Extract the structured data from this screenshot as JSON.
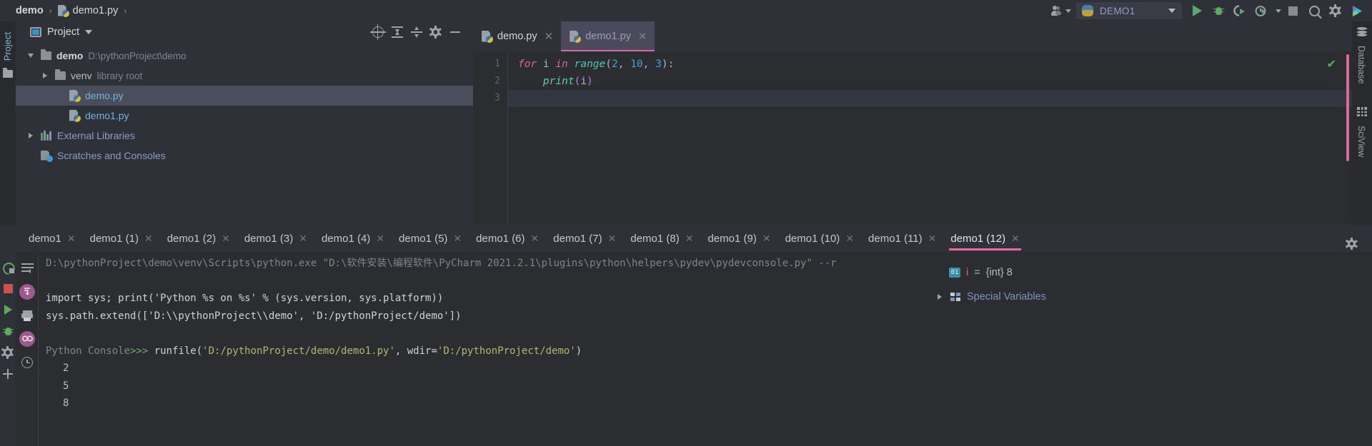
{
  "breadcrumb": {
    "project": "demo",
    "separator": "›",
    "file": "demo1.py",
    "trailing": "›"
  },
  "toolbar": {
    "user_icon": "user-group-icon",
    "run_config": "DEMO1",
    "run_label": "run-icon",
    "debug_label": "debug-icon",
    "coverage_label": "run-with-coverage-icon",
    "profile_label": "profile-icon",
    "stop_label": "stop-icon",
    "search_label": "search-icon",
    "settings_label": "settings-icon",
    "updates_label": "updates-icon"
  },
  "left_strip": {
    "project_label": "Project"
  },
  "project_panel": {
    "title": "Project",
    "tree": [
      {
        "name": "demo",
        "detail": "D:\\pythonProject\\demo",
        "icon": "folder-icon",
        "expanded": true,
        "depth": 0,
        "bold": true,
        "selected": false
      },
      {
        "name": "venv",
        "detail": "library root",
        "icon": "folder-icon",
        "expanded": false,
        "depth": 1,
        "bold": false,
        "selected": false
      },
      {
        "name": "demo.py",
        "detail": "",
        "icon": "python-file-icon",
        "expanded": null,
        "depth": 2,
        "bold": false,
        "selected": true
      },
      {
        "name": "demo1.py",
        "detail": "",
        "icon": "python-file-icon",
        "expanded": null,
        "depth": 2,
        "bold": false,
        "selected": false
      },
      {
        "name": "External Libraries",
        "detail": "",
        "icon": "libraries-icon",
        "expanded": false,
        "depth": 0,
        "bold": false,
        "selected": false
      },
      {
        "name": "Scratches and Consoles",
        "detail": "",
        "icon": "scratches-icon",
        "expanded": null,
        "depth": 0,
        "bold": false,
        "selected": false
      }
    ]
  },
  "editor_toolbar": [
    {
      "name": "select-opened-file-icon"
    },
    {
      "name": "collapse-all-icon"
    },
    {
      "name": "expand-all-icon"
    },
    {
      "name": "settings-icon"
    },
    {
      "name": "hide-icon"
    }
  ],
  "editor": {
    "tabs": [
      {
        "label": "demo.py",
        "active": false
      },
      {
        "label": "demo1.py",
        "active": true
      }
    ],
    "close_glyph": "✕",
    "line_numbers": [
      "1",
      "2",
      "3"
    ],
    "code": {
      "line1": {
        "kw1": "for",
        "var": " i ",
        "kw2": "in",
        "fn": " range",
        "open": "(",
        "a": "2",
        "c1": ", ",
        "b": "10",
        "c2": ", ",
        "c": "3",
        "close": "):"
      },
      "line2": {
        "indent": "    ",
        "fn": "print",
        "open": "(",
        "arg": "i",
        "close": ")"
      }
    },
    "inspection_status": "✔"
  },
  "right_strip": {
    "database": "Database",
    "sciview": "SciView"
  },
  "console_tabs": {
    "tabs": [
      {
        "label": "demo1",
        "active": false
      },
      {
        "label": "demo1 (1)",
        "active": false
      },
      {
        "label": "demo1 (2)",
        "active": false
      },
      {
        "label": "demo1 (3)",
        "active": false
      },
      {
        "label": "demo1 (4)",
        "active": false
      },
      {
        "label": "demo1 (5)",
        "active": false
      },
      {
        "label": "demo1 (6)",
        "active": false
      },
      {
        "label": "demo1 (7)",
        "active": false
      },
      {
        "label": "demo1 (8)",
        "active": false
      },
      {
        "label": "demo1 (9)",
        "active": false
      },
      {
        "label": "demo1 (10)",
        "active": false
      },
      {
        "label": "demo1 (11)",
        "active": false
      },
      {
        "label": "demo1 (12)",
        "active": true
      }
    ],
    "close_glyph": "✕",
    "settings_icon": "settings-icon",
    "hide_icon": "hide-icon"
  },
  "console_gutter_left": [
    {
      "name": "rerun-icon"
    },
    {
      "name": "stop-icon"
    },
    {
      "name": "run-icon"
    },
    {
      "name": "debug-icon"
    },
    {
      "name": "settings-icon"
    },
    {
      "name": "add-icon"
    }
  ],
  "console_gutter_right": [
    {
      "name": "soft-wrap-icon"
    },
    {
      "name": "scroll-to-end-icon",
      "glyph": "↧"
    },
    {
      "name": "print-icon"
    },
    {
      "name": "show-variables-icon",
      "glyph": "oo"
    },
    {
      "name": "history-icon"
    }
  ],
  "console_output": {
    "line_cmd": "D:\\pythonProject\\demo\\venv\\Scripts\\python.exe \"D:\\软件安装\\编程软件\\PyCharm 2021.2.1\\plugins\\python\\helpers\\pydev\\pydevconsole.py\" --r",
    "line_import": "import sys; print('Python %s on %s' % (sys.version, sys.platform))",
    "line_syspath": "sys.path.extend(['D:\\\\pythonProject\\\\demo', 'D:/pythonProject/demo'])",
    "prompt_label": "Python Console",
    "prompt_arrows": ">>> ",
    "runfile_call": "runfile(",
    "runfile_path": "'D:/pythonProject/demo/demo1.py'",
    "runfile_comma": ", ",
    "runfile_wdir_key": "wdir=",
    "runfile_wdir_val": "'D:/pythonProject/demo'",
    "runfile_close": ")",
    "results": [
      "2",
      "5",
      "8"
    ]
  },
  "variables": {
    "rows": [
      {
        "badge": "01",
        "name": "i",
        "eq": " = ",
        "value": "{int} 8",
        "expandable": false
      },
      {
        "label": "Special Variables",
        "expandable": true
      }
    ]
  }
}
